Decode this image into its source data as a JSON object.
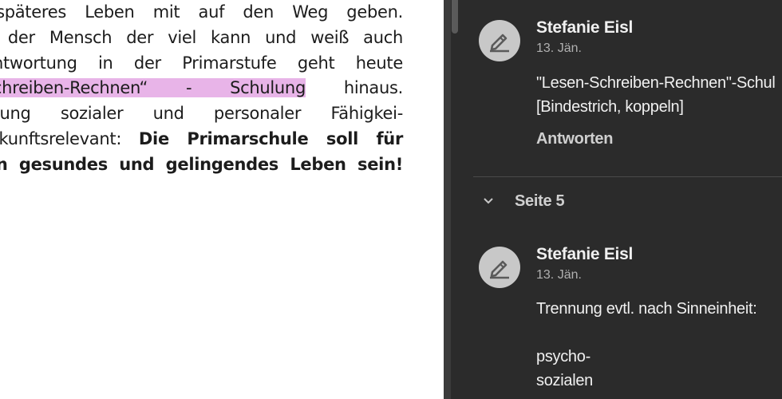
{
  "document": {
    "lines": [
      {
        "pre": "ihr späteres Leben mit auf den Weg geben.",
        "hl": "",
        "post": "",
        "bold": false
      },
      {
        "pre": "dass der Mensch der viel kann und weiß auch",
        "hl": "",
        "post": "",
        "bold": false
      },
      {
        "pre": "Verantwortung in der Primarstufe geht heute",
        "hl": "",
        "post": "",
        "bold": false
      },
      {
        "pre": "",
        "hl": "en-Schreiben-Rechnen“ - Schulung",
        "post": " hinaus.",
        "bold": false
      },
      {
        "pre": "örderung sozialer und personaler Fähigkei-",
        "hl": "",
        "post": "",
        "bold": false
      },
      {
        "pre": "t zukunftsrelevant: ",
        "hl": "",
        "post": "Die Primarschule soll für",
        "bold": "post"
      },
      {
        "pre": "n ein gesundes und gelingendes Leben sein!",
        "hl": "",
        "post": "",
        "bold": true
      }
    ]
  },
  "comments": [
    {
      "author": "Stefanie Eisl",
      "date": "13. Jän.",
      "body": "\"Lesen-Schreiben-Rechnen\"-Schul\n[Bindestrich, koppeln]",
      "reply": "Antworten"
    },
    {
      "author": "Stefanie Eisl",
      "date": "13. Jän.",
      "body": "Trennung evtl. nach Sinneinheit:\n\npsycho-\nsozialen"
    }
  ],
  "section": {
    "label": "Seite 5"
  },
  "colors": {
    "highlight": "#e8b4e8",
    "panel_bg": "#2b2b2b"
  }
}
